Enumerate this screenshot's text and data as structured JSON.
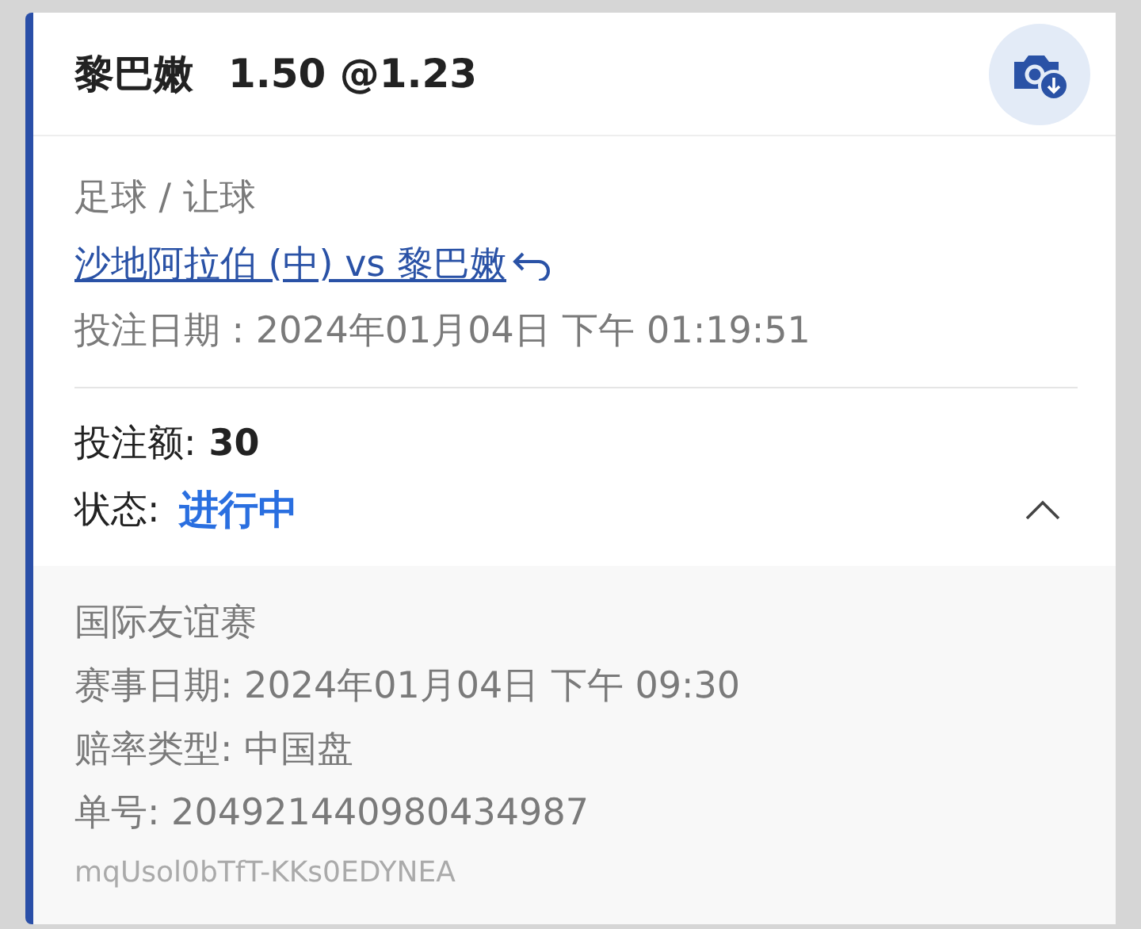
{
  "header": {
    "team": "黎巴嫩",
    "line": "1.50 @1.23"
  },
  "bet": {
    "sport_market": "足球 / 让球",
    "match_link": "沙地阿拉伯 (中) vs 黎巴嫩",
    "bet_date": "投注日期 : 2024年01月04日 下午 01:19:51"
  },
  "stake": {
    "label": "投注额:",
    "value": "30"
  },
  "status": {
    "label": "状态:",
    "value": "进行中",
    "expanded": true
  },
  "details": [
    {
      "text": "国际友谊赛",
      "kind": "line"
    },
    {
      "text": "赛事日期: 2024年01月04日 下午 09:30",
      "kind": "line"
    },
    {
      "text": "赔率类型: 中国盘",
      "kind": "line"
    },
    {
      "text": "单号: 204921440980434987",
      "kind": "line"
    },
    {
      "text": "mqUsol0bTfT-KKs0EDYNEA",
      "kind": "code"
    }
  ]
}
